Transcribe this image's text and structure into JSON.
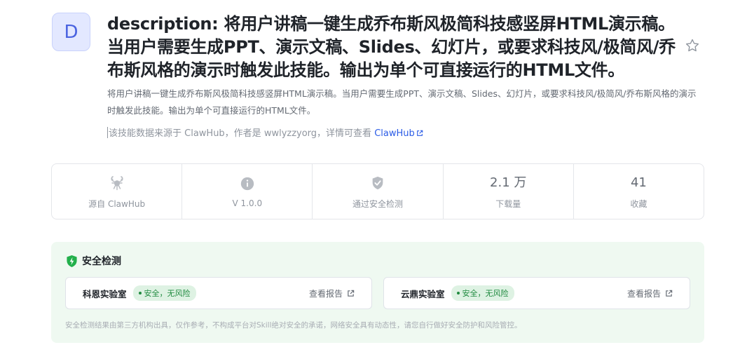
{
  "skill": {
    "avatar_letter": "D",
    "title": "description: 将用户讲稿一键生成乔布斯风极简科技感竖屏HTML演示稿。当用户需要生成PPT、演示文稿、Slides、幻灯片，或要求科技风/极简风/乔布斯风格的演示时触发此技能。输出为单个可直接运行的HTML文件。",
    "description": "将用户讲稿一键生成乔布斯风极简科技感竖屏HTML演示稿。当用户需要生成PPT、演示文稿、Slides、幻灯片，或要求科技风/极简风/乔布斯风格的演示时触发此技能。输出为单个可直接运行的HTML文件。",
    "source_prefix": "该技能数据来源于 ClawHub，作者是 wwlyzzyorg，详情可查看 ",
    "source_link": "ClawHub"
  },
  "icons": {
    "favorite": "star-outline-icon",
    "external": "external-link-icon",
    "source": "lobster-claw-icon",
    "version": "info-circle-icon",
    "security": "shield-check-icon"
  },
  "stats": [
    {
      "icon": "lobster-claw-icon",
      "value": "",
      "label": "源自 ClawHub"
    },
    {
      "icon": "info-circle-icon",
      "value": "",
      "label": "V 1.0.0"
    },
    {
      "icon": "shield-check-icon",
      "value": "",
      "label": "通过安全检测"
    },
    {
      "icon": "",
      "value": "2.1 万",
      "label": "下载量"
    },
    {
      "icon": "",
      "value": "41",
      "label": "收藏"
    }
  ],
  "security": {
    "title": "安全检测",
    "labs": [
      {
        "name": "科恩实验室",
        "status": "安全，无风险",
        "report": "查看报告"
      },
      {
        "name": "云鼎实验室",
        "status": "安全，无风险",
        "report": "查看报告"
      }
    ],
    "disclaimer": "安全检测结果由第三方机构出具，仅作参考，不构成平台对Skill绝对安全的承诺，网络安全具有动态性，请您自行做好安全防护和风险管控。"
  },
  "colors": {
    "accent": "#2b5ce6",
    "avatar_bg": "#e3e8ff",
    "safe_green": "#1f8a3f",
    "security_bg": "#eff9f1",
    "shield_green": "#22b04b"
  }
}
